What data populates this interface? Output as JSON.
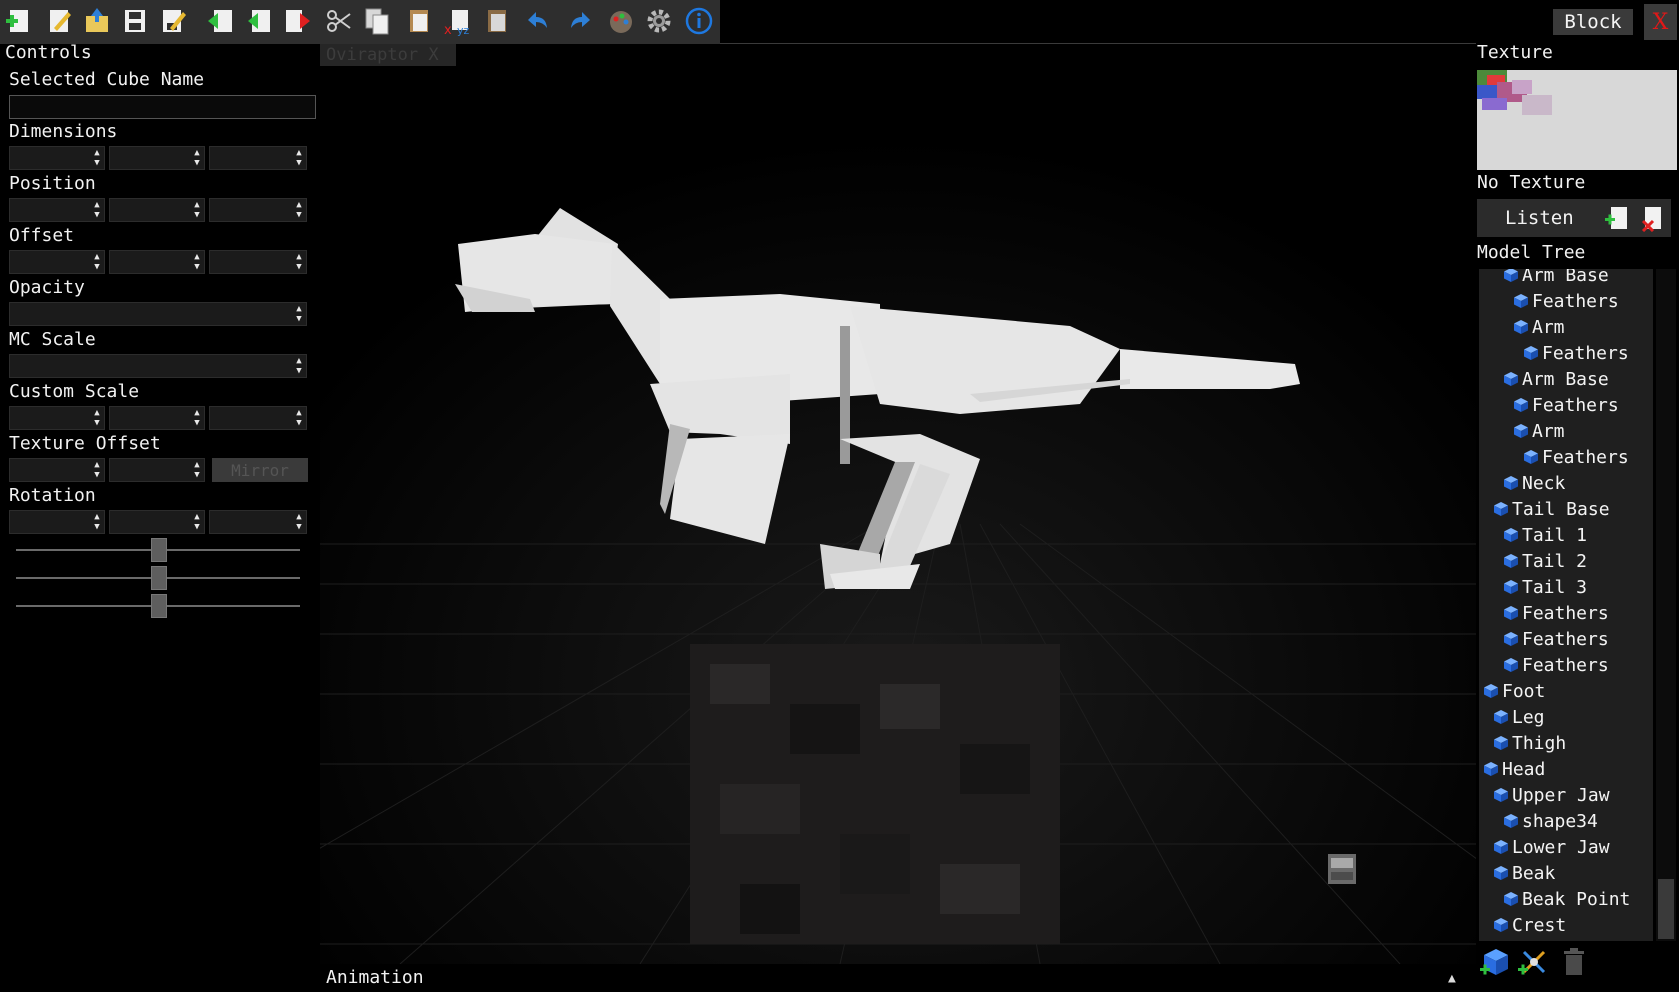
{
  "toolbar": {
    "icons": [
      "new-icon",
      "edit-icon",
      "open-folder-icon",
      "save-icon",
      "save-as-icon",
      "import-icon",
      "import-merge-icon",
      "export-icon",
      "cut-icon",
      "copy-icon",
      "paste-icon",
      "paste-replace-icon",
      "paste-special-icon",
      "undo-icon",
      "redo-icon",
      "palette-icon",
      "settings-icon",
      "info-icon"
    ],
    "block_label": "Block",
    "close_label": "X"
  },
  "controls": {
    "title": "Controls",
    "cube_name_label": "Selected Cube Name",
    "cube_name_value": "",
    "dimensions_label": "Dimensions",
    "position_label": "Position",
    "offset_label": "Offset",
    "opacity_label": "Opacity",
    "mc_scale_label": "MC Scale",
    "custom_scale_label": "Custom Scale",
    "texture_offset_label": "Texture Offset",
    "mirror_label": "Mirror",
    "rotation_label": "Rotation",
    "rotation_sliders": [
      0.5,
      0.5,
      0.5
    ]
  },
  "viewport": {
    "tab_label": "Oviraptor X",
    "animation_label": "Animation",
    "animation_arrow": "▲"
  },
  "texture": {
    "title": "Texture",
    "status": "No Texture"
  },
  "listen": {
    "label": "Listen"
  },
  "model_tree": {
    "title": "Model Tree",
    "items": [
      {
        "label": "Arm Base",
        "depth": 2
      },
      {
        "label": "Feathers",
        "depth": 3
      },
      {
        "label": "Arm",
        "depth": 3
      },
      {
        "label": "Feathers",
        "depth": 4
      },
      {
        "label": "Arm Base",
        "depth": 2
      },
      {
        "label": "Feathers",
        "depth": 3
      },
      {
        "label": "Arm",
        "depth": 3
      },
      {
        "label": "Feathers",
        "depth": 4
      },
      {
        "label": "Neck",
        "depth": 2
      },
      {
        "label": "Tail Base",
        "depth": 1
      },
      {
        "label": "Tail 1",
        "depth": 2
      },
      {
        "label": "Tail 2",
        "depth": 2
      },
      {
        "label": "Tail 3",
        "depth": 2
      },
      {
        "label": "Feathers",
        "depth": 2
      },
      {
        "label": "Feathers",
        "depth": 2
      },
      {
        "label": "Feathers",
        "depth": 2
      },
      {
        "label": "Foot",
        "depth": 0
      },
      {
        "label": "Leg",
        "depth": 1
      },
      {
        "label": "Thigh",
        "depth": 1
      },
      {
        "label": "Head",
        "depth": 0
      },
      {
        "label": "Upper Jaw",
        "depth": 1
      },
      {
        "label": "shape34",
        "depth": 2
      },
      {
        "label": "Lower Jaw",
        "depth": 1
      },
      {
        "label": "Beak",
        "depth": 1
      },
      {
        "label": "Beak Point",
        "depth": 2
      },
      {
        "label": "Crest",
        "depth": 1
      }
    ]
  },
  "tree_actions": [
    "add-cube-icon",
    "add-group-icon",
    "delete-icon"
  ],
  "colors": {
    "toolbar_bg": "#2e2e2e",
    "tree_bg": "#1f1f1f",
    "cube_blue": "#2a6de0",
    "close_red": "#e01818",
    "model_white": "#e6e6e6"
  }
}
